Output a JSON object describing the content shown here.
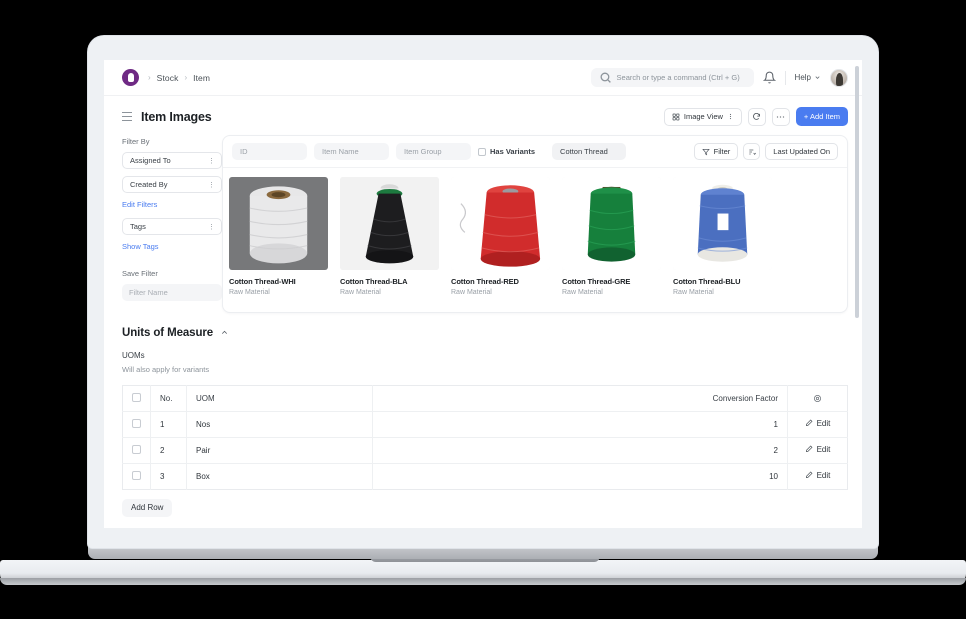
{
  "navbar": {
    "logo_icon": "frappe-logo-icon",
    "breadcrumbs": [
      "Stock",
      "Item"
    ],
    "separator": "›",
    "search": {
      "icon": "search-icon",
      "placeholder": "Search or type a command (Ctrl + G)",
      "value": ""
    },
    "notification_icon": "bell-icon",
    "help_label": "Help",
    "help_caret_icon": "chevron-down-icon",
    "avatar_icon": "user-avatar"
  },
  "page": {
    "menu_icon": "hamburger-icon",
    "title": "Item Images",
    "actions": {
      "view_icon": "grid-view-icon",
      "view_label": "Image View",
      "view_caret_icon": "kebab-vertical-icon",
      "refresh_icon": "refresh-icon",
      "more_icon": "ellipsis-icon",
      "add_label": "+ Add Item"
    }
  },
  "sidebar": {
    "filter_by_label": "Filter By",
    "selects": [
      {
        "label": "Assigned To",
        "caret_icon": "kebab-vertical-icon"
      },
      {
        "label": "Created By",
        "caret_icon": "kebab-vertical-icon"
      }
    ],
    "edit_filters_link": "Edit Filters",
    "tags_select": {
      "label": "Tags",
      "caret_icon": "kebab-vertical-icon"
    },
    "show_tags_link": "Show Tags",
    "save_filter_label": "Save Filter",
    "filter_name_placeholder": "Filter Name",
    "filter_name_value": ""
  },
  "filter_bar": {
    "fields": [
      {
        "name": "id",
        "placeholder": "ID",
        "value": ""
      },
      {
        "name": "item-name",
        "placeholder": "Item Name",
        "value": ""
      },
      {
        "name": "item-group",
        "placeholder": "Item Group",
        "value": ""
      }
    ],
    "has_variants": {
      "label": "Has Variants",
      "checked": false
    },
    "active_tag": "Cotton Thread",
    "filter_button": {
      "icon": "funnel-icon",
      "label": "Filter"
    },
    "sort_icon": "sort-icon",
    "sort_label": "Last Updated On"
  },
  "cards": [
    {
      "name": "Cotton Thread-WHI",
      "meta": "Raw Material",
      "color": "#e9e9ea",
      "accent": "#8b6a3f",
      "bg": "#77787a"
    },
    {
      "name": "Cotton Thread-BLA",
      "meta": "Raw Material",
      "color": "#1d1d1f",
      "accent": "#1d7a3f",
      "bg": "#f2f2f2"
    },
    {
      "name": "Cotton Thread-RED",
      "meta": "Raw Material",
      "color": "#d12c2c",
      "accent": "#b02020",
      "bg": "#ffffff"
    },
    {
      "name": "Cotton Thread-GRE",
      "meta": "Raw Material",
      "color": "#16803c",
      "accent": "#4a3a22",
      "bg": "#ffffff"
    },
    {
      "name": "Cotton Thread-BLU",
      "meta": "Raw Material",
      "color": "#4b6fc0",
      "accent": "#efeee8",
      "bg": "#ffffff"
    }
  ],
  "uom_section": {
    "title": "Units of Measure",
    "collapse_icon": "chevron-up-icon",
    "field_label": "UOMs",
    "field_hint": "Will also apply for variants",
    "columns": [
      "",
      "No.",
      "UOM",
      "Conversion Factor",
      "settings-icon"
    ],
    "rows": [
      {
        "no": "1",
        "uom": "Nos",
        "conversion_factor": "1",
        "action": "Edit",
        "action_icon": "pencil-icon"
      },
      {
        "no": "2",
        "uom": "Pair",
        "conversion_factor": "2",
        "action": "Edit",
        "action_icon": "pencil-icon"
      },
      {
        "no": "3",
        "uom": "Box",
        "conversion_factor": "10",
        "action": "Edit",
        "action_icon": "pencil-icon"
      }
    ],
    "add_row_label": "Add Row"
  },
  "theme": {
    "primary_blue": "#4a7cf0",
    "link_blue": "#4a7cf0",
    "brand_purple": "#6f2a84",
    "text_dark": "#1c2024",
    "text_muted": "#8d949b"
  }
}
